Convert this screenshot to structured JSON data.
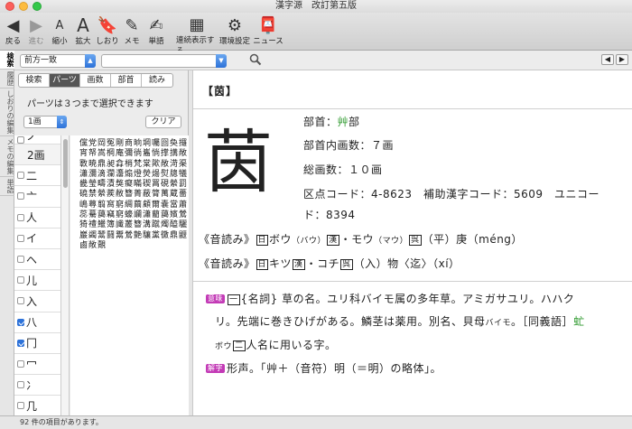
{
  "window": {
    "title": "漢字源　改訂第五版"
  },
  "toolbar": {
    "items": [
      {
        "label": "戻る",
        "icon": "back-arrow-icon",
        "glyph": "◀"
      },
      {
        "label": "進む",
        "icon": "forward-arrow-icon",
        "glyph": "▶"
      },
      {
        "label": "縮小",
        "icon": "font-smaller-icon",
        "glyph": "A"
      },
      {
        "label": "拡大",
        "icon": "font-larger-icon",
        "glyph": "A"
      },
      {
        "label": "しおり",
        "icon": "bookmark-icon",
        "glyph": "🔖"
      },
      {
        "label": "メモ",
        "icon": "memo-icon",
        "glyph": "✎"
      },
      {
        "label": "単語",
        "icon": "word-icon",
        "glyph": "✍"
      },
      {
        "label": "連続表示する",
        "icon": "continuous-display-icon",
        "glyph": "▦"
      },
      {
        "label": "環境設定",
        "icon": "gear-icon",
        "glyph": "⚙"
      },
      {
        "label": "ニュース",
        "icon": "news-icon",
        "glyph": "📮"
      }
    ]
  },
  "side_tabs": [
    "検索",
    "履歴",
    "しおりの編集",
    "メモの編集",
    "単語"
  ],
  "search": {
    "mode": "前方一致",
    "query": ""
  },
  "search_tabs": [
    "検索",
    "パーツ",
    "画数",
    "部首",
    "読み"
  ],
  "active_search_tab": 1,
  "parts": {
    "hint": "パーツは３つまで選択できます",
    "stroke_value": "1画",
    "clear_label": "クリア",
    "list": [
      {
        "label": "ノ",
        "checked": false,
        "partial": true
      },
      {
        "label": "2画",
        "header": true
      },
      {
        "label": "二",
        "checked": false
      },
      {
        "label": "亠",
        "checked": false
      },
      {
        "label": "人",
        "checked": false
      },
      {
        "label": "イ",
        "checked": false
      },
      {
        "label": "ヘ",
        "checked": false
      },
      {
        "label": "儿",
        "checked": false
      },
      {
        "label": "入",
        "checked": false
      },
      {
        "label": "八",
        "checked": true
      },
      {
        "label": "冂",
        "checked": true
      },
      {
        "label": "冖",
        "checked": false
      },
      {
        "label": "冫",
        "checked": false
      },
      {
        "label": "几",
        "checked": false
      }
    ],
    "results": "儻党岡冤剛商晌堈囑囼奐攞宵帑嵩棡庵彌徜巂惝撑搆敞斁暁鼎昶搻梢梵棠歟敞渮渠瀟瀰滴瀾灋煽燈熒煬熨牕犠畿瑩疇漬獘癡瞞碶罥硯縈罰磽禁縈蒺敝簪菁蔽膂萬蔵薔嶋蕁翦窩窮綢繭顧爾嚢當蕭蕊驀藹竊窮蠔讕瀟藺藹嬪鶯猗禮鱲簿讖叢簪溝蹴燭醯驪巖蠲鬵鬪鬻鶯艶驤黨黴鼎鼴鹵敞覿"
  },
  "entry": {
    "headword": "【茵】",
    "char": "茵",
    "radical_label": "部首：",
    "radical": "艸",
    "radical_suffix": "部",
    "inner_strokes": "部首内画数：７画",
    "total_strokes": "総画数：１０画",
    "code_line1": "区点コード：4-8623　補助漢字コード：5609　ユニコー",
    "code_line2": "ド：8394",
    "reading1": {
      "prefix": "《音読み》",
      "m1": "日",
      "a": "ボウ",
      "a_kana": "（バウ）",
      "m2": "漢",
      "b": "・モウ",
      "b_kana": "（マウ）",
      "m3": "呉",
      "c": "（平）庚（méng）"
    },
    "reading2": {
      "prefix": "《音読み》",
      "m1": "日",
      "a": "キツ",
      "m2": "漢",
      "b": "・コチ",
      "m3": "呉",
      "c": "（入）物〈迄〉（xí）"
    },
    "meaning_tag": "意味",
    "meaning_num": "一",
    "meaning_line1": "{名詞} 草の名。ユリ科バイモ属の多年草。アミガサユリ。ハハク",
    "meaning_line2a": "リ。先端に巻きひげがある。鱗茎は薬用。別名、貝母",
    "meaning_line2_kana": "バイモ",
    "meaning_line2b": "。［同義語］",
    "meaning_line2_link": "虻",
    "meaning_line3_kana": "ボウ",
    "meaning_line3_num": "二",
    "meaning_line3": "人名に用いる字。",
    "etym_tag": "解字",
    "etym": "形声。「艸＋（音符）明（＝明）の略体」。"
  },
  "status": "92 件の項目があります。"
}
